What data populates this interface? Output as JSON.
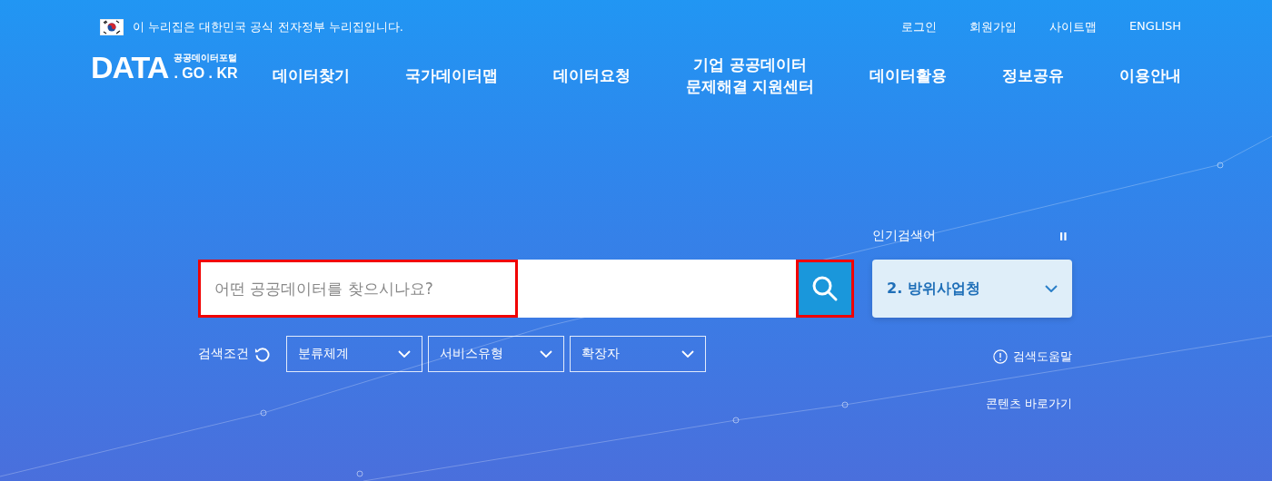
{
  "notice": {
    "text": "이 누리집은 대한민국 공식 전자정부 누리집입니다."
  },
  "util_links": [
    "로그인",
    "회원가입",
    "사이트맵",
    "ENGLISH"
  ],
  "logo": {
    "main": "DATA",
    "sub": "공공데이터포털",
    "domain": ". GO . KR"
  },
  "nav": [
    {
      "lines": [
        "데이터찾기"
      ]
    },
    {
      "lines": [
        "국가데이터맵"
      ]
    },
    {
      "lines": [
        "데이터요청"
      ]
    },
    {
      "lines": [
        "기업 공공데이터",
        "문제해결 지원센터"
      ]
    },
    {
      "lines": [
        "데이터활용"
      ]
    },
    {
      "lines": [
        "정보공유"
      ]
    },
    {
      "lines": [
        "이용안내"
      ]
    }
  ],
  "search": {
    "placeholder": "어떤 공공데이터를 찾으시나요?",
    "highlighted": true,
    "button_highlighted": true
  },
  "filters": {
    "label": "검색조건",
    "selects": [
      {
        "label": "분류체계"
      },
      {
        "label": "서비스유형"
      },
      {
        "label": "확장자"
      }
    ]
  },
  "popular": {
    "title": "인기검색어",
    "current": "2. 방위사업청"
  },
  "help_link": "검색도움말",
  "content_link": "콘텐츠 바로가기"
}
